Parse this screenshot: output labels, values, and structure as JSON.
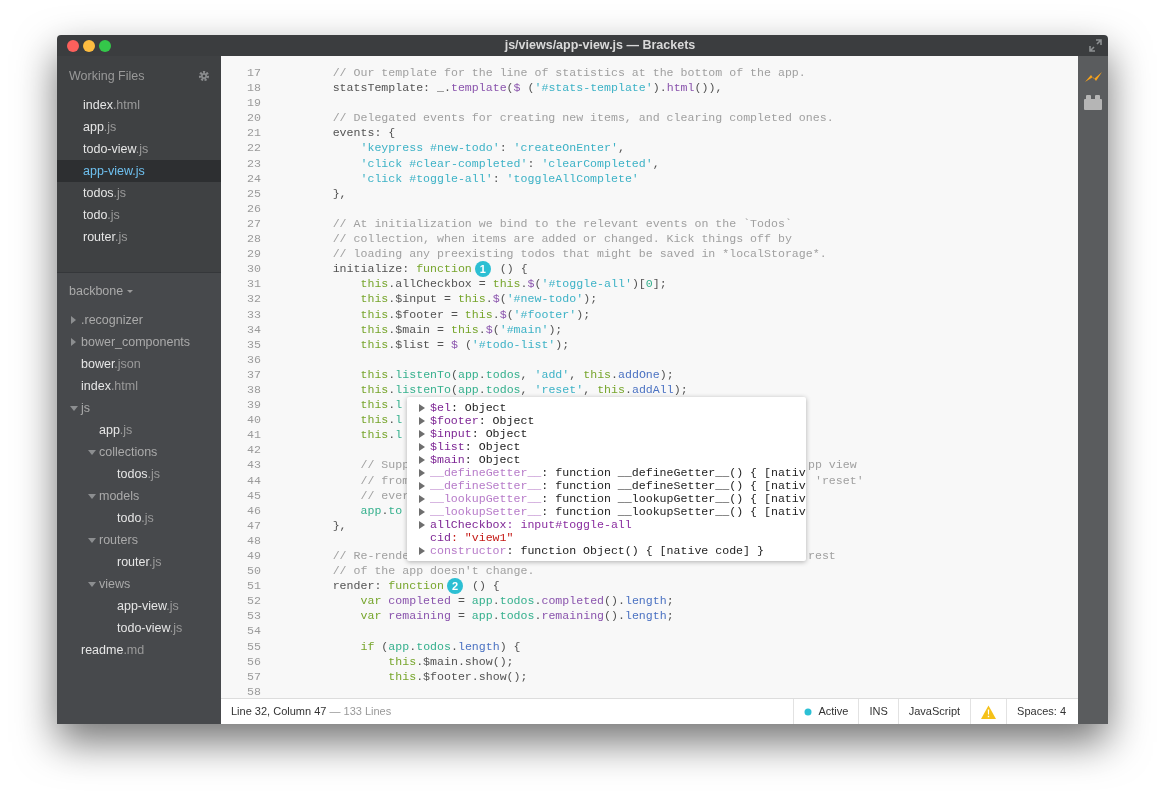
{
  "window": {
    "title": "js/views/app-view.js — Brackets"
  },
  "sidebar": {
    "working_files_title": "Working Files",
    "working_files": [
      {
        "name": "index",
        "ext": ".html",
        "selected": false
      },
      {
        "name": "app",
        "ext": ".js",
        "selected": false
      },
      {
        "name": "todo-view",
        "ext": ".js",
        "selected": false
      },
      {
        "name": "app-view",
        "ext": ".js",
        "selected": true
      },
      {
        "name": "todos",
        "ext": ".js",
        "selected": false
      },
      {
        "name": "todo",
        "ext": ".js",
        "selected": false
      },
      {
        "name": "router",
        "ext": ".js",
        "selected": false
      }
    ],
    "project": "backbone",
    "tree": [
      {
        "kind": "folder",
        "name": ".recognizer",
        "expanded": false
      },
      {
        "kind": "folder",
        "name": "bower_components",
        "expanded": false
      },
      {
        "kind": "file",
        "name": "bower",
        "ext": ".json"
      },
      {
        "kind": "file",
        "name": "index",
        "ext": ".html"
      },
      {
        "kind": "folder",
        "name": "js",
        "expanded": true,
        "children": [
          {
            "kind": "file",
            "name": "app",
            "ext": ".js"
          },
          {
            "kind": "folder",
            "name": "collections",
            "expanded": true,
            "children": [
              {
                "kind": "file",
                "name": "todos",
                "ext": ".js"
              }
            ]
          },
          {
            "kind": "folder",
            "name": "models",
            "expanded": true,
            "children": [
              {
                "kind": "file",
                "name": "todo",
                "ext": ".js"
              }
            ]
          },
          {
            "kind": "folder",
            "name": "routers",
            "expanded": true,
            "children": [
              {
                "kind": "file",
                "name": "router",
                "ext": ".js"
              }
            ]
          },
          {
            "kind": "folder",
            "name": "views",
            "expanded": true,
            "children": [
              {
                "kind": "file",
                "name": "app-view",
                "ext": ".js"
              },
              {
                "kind": "file",
                "name": "todo-view",
                "ext": ".js"
              }
            ]
          }
        ]
      },
      {
        "kind": "file",
        "name": "readme",
        "ext": ".md"
      }
    ]
  },
  "editor": {
    "lines": [
      {
        "number": "17",
        "tokens": [
          {
            "text": "        // Our template for the line of statistics at the bottom of the app.",
            "kind": "comment"
          }
        ]
      },
      {
        "number": "18",
        "tokens": [
          {
            "text": "        statsTemplate: _.",
            "kind": "plain"
          },
          {
            "text": "template",
            "kind": "func"
          },
          {
            "text": "(",
            "kind": "plain"
          },
          {
            "text": "$",
            "kind": "func"
          },
          {
            "text": " (",
            "kind": "plain"
          },
          {
            "text": "'#stats-template'",
            "kind": "string"
          },
          {
            "text": ").",
            "kind": "plain"
          },
          {
            "text": "html",
            "kind": "func"
          },
          {
            "text": "()),",
            "kind": "plain"
          }
        ]
      },
      {
        "number": "19"
      },
      {
        "number": "20",
        "tokens": [
          {
            "text": "        // Delegated events for creating new items, and clearing completed ones.",
            "kind": "comment"
          }
        ]
      },
      {
        "number": "21",
        "tokens": [
          {
            "text": "        events: {",
            "kind": "plain"
          }
        ]
      },
      {
        "number": "22",
        "tokens": [
          {
            "text": "            'keypress #new-todo'",
            "kind": "string"
          },
          {
            "text": ": ",
            "kind": "plain"
          },
          {
            "text": "'createOnEnter'",
            "kind": "string"
          },
          {
            "text": ",",
            "kind": "plain"
          }
        ]
      },
      {
        "number": "23",
        "tokens": [
          {
            "text": "            'click #clear-completed'",
            "kind": "string"
          },
          {
            "text": ": ",
            "kind": "plain"
          },
          {
            "text": "'clearCompleted'",
            "kind": "string"
          },
          {
            "text": ",",
            "kind": "plain"
          }
        ]
      },
      {
        "number": "24",
        "tokens": [
          {
            "text": "            'click #toggle-all'",
            "kind": "string"
          },
          {
            "text": ": ",
            "kind": "plain"
          },
          {
            "text": "'toggleAllComplete'",
            "kind": "string"
          }
        ]
      },
      {
        "number": "25",
        "tokens": [
          {
            "text": "        },",
            "kind": "plain"
          }
        ]
      },
      {
        "number": "26"
      },
      {
        "number": "27",
        "tokens": [
          {
            "text": "        // At initialization we bind to the relevant events on the `Todos`",
            "kind": "comment"
          }
        ]
      },
      {
        "number": "28",
        "tokens": [
          {
            "text": "        // collection, when items are added or changed. Kick things off by",
            "kind": "comment"
          }
        ]
      },
      {
        "number": "29",
        "tokens": [
          {
            "text": "        // loading any preexisting todos that might be saved in *localStorage*.",
            "kind": "comment"
          }
        ]
      },
      {
        "number": "30",
        "tokens": [
          {
            "text": "        initialize: ",
            "kind": "plain"
          },
          {
            "text": "function",
            "kind": "keyword"
          },
          {
            "text": "1",
            "kind": "badge"
          },
          {
            "text": "() {",
            "kind": "plain"
          }
        ]
      },
      {
        "number": "31",
        "tokens": [
          {
            "text": "            this",
            "kind": "keyword"
          },
          {
            "text": ".allCheckbox = ",
            "kind": "plain"
          },
          {
            "text": "this",
            "kind": "keyword"
          },
          {
            "text": ".",
            "kind": "plain"
          },
          {
            "text": "$",
            "kind": "func"
          },
          {
            "text": "(",
            "kind": "plain"
          },
          {
            "text": "'#toggle-all'",
            "kind": "string"
          },
          {
            "text": ")[",
            "kind": "plain"
          },
          {
            "text": "0",
            "kind": "ident"
          },
          {
            "text": "];",
            "kind": "plain"
          }
        ]
      },
      {
        "number": "32",
        "tokens": [
          {
            "text": "            this",
            "kind": "keyword"
          },
          {
            "text": ".$input = ",
            "kind": "plain"
          },
          {
            "text": "this",
            "kind": "keyword"
          },
          {
            "text": ".",
            "kind": "plain"
          },
          {
            "text": "$",
            "kind": "func"
          },
          {
            "text": "(",
            "kind": "plain"
          },
          {
            "text": "'#new-todo'",
            "kind": "string"
          },
          {
            "text": ");",
            "kind": "plain"
          }
        ]
      },
      {
        "number": "33",
        "tokens": [
          {
            "text": "            this",
            "kind": "keyword"
          },
          {
            "text": ".$footer = ",
            "kind": "plain"
          },
          {
            "text": "this",
            "kind": "keyword"
          },
          {
            "text": ".",
            "kind": "plain"
          },
          {
            "text": "$",
            "kind": "func"
          },
          {
            "text": "(",
            "kind": "plain"
          },
          {
            "text": "'#footer'",
            "kind": "string"
          },
          {
            "text": ");",
            "kind": "plain"
          }
        ]
      },
      {
        "number": "34",
        "tokens": [
          {
            "text": "            this",
            "kind": "keyword"
          },
          {
            "text": ".$main = ",
            "kind": "plain"
          },
          {
            "text": "this",
            "kind": "keyword"
          },
          {
            "text": ".",
            "kind": "plain"
          },
          {
            "text": "$",
            "kind": "func"
          },
          {
            "text": "(",
            "kind": "plain"
          },
          {
            "text": "'#main'",
            "kind": "string"
          },
          {
            "text": ");",
            "kind": "plain"
          }
        ]
      },
      {
        "number": "35",
        "tokens": [
          {
            "text": "            this",
            "kind": "keyword"
          },
          {
            "text": ".$list = ",
            "kind": "plain"
          },
          {
            "text": "$",
            "kind": "func"
          },
          {
            "text": " (",
            "kind": "plain"
          },
          {
            "text": "'#todo-list'",
            "kind": "string"
          },
          {
            "text": ");",
            "kind": "plain"
          }
        ]
      },
      {
        "number": "36"
      },
      {
        "number": "37",
        "tokens": [
          {
            "text": "            this",
            "kind": "keyword"
          },
          {
            "text": ".",
            "kind": "plain"
          },
          {
            "text": "listenTo",
            "kind": "ident"
          },
          {
            "text": "(",
            "kind": "plain"
          },
          {
            "text": "app",
            "kind": "ident"
          },
          {
            "text": ".",
            "kind": "plain"
          },
          {
            "text": "todos",
            "kind": "ident"
          },
          {
            "text": ", ",
            "kind": "plain"
          },
          {
            "text": "'add'",
            "kind": "string"
          },
          {
            "text": ", ",
            "kind": "plain"
          },
          {
            "text": "this",
            "kind": "keyword"
          },
          {
            "text": ".",
            "kind": "plain"
          },
          {
            "text": "addOne",
            "kind": "prop"
          },
          {
            "text": ");",
            "kind": "plain"
          }
        ]
      },
      {
        "number": "38",
        "tokens": [
          {
            "text": "            this",
            "kind": "keyword"
          },
          {
            "text": ".",
            "kind": "plain"
          },
          {
            "text": "listenTo",
            "kind": "ident"
          },
          {
            "text": "(",
            "kind": "plain"
          },
          {
            "text": "app",
            "kind": "ident"
          },
          {
            "text": ".",
            "kind": "plain"
          },
          {
            "text": "todos",
            "kind": "ident"
          },
          {
            "text": ", ",
            "kind": "plain"
          },
          {
            "text": "'reset'",
            "kind": "string"
          },
          {
            "text": ", ",
            "kind": "plain"
          },
          {
            "text": "this",
            "kind": "keyword"
          },
          {
            "text": ".",
            "kind": "plain"
          },
          {
            "text": "addAll",
            "kind": "prop"
          },
          {
            "text": ");",
            "kind": "plain"
          }
        ]
      },
      {
        "number": "39",
        "tokens": [
          {
            "text": "            this",
            "kind": "keyword"
          },
          {
            "text": ".",
            "kind": "plain"
          },
          {
            "text": "l",
            "kind": "ident"
          }
        ]
      },
      {
        "number": "40",
        "tokens": [
          {
            "text": "            this",
            "kind": "keyword"
          },
          {
            "text": ".",
            "kind": "plain"
          },
          {
            "text": "l",
            "kind": "ident"
          }
        ]
      },
      {
        "number": "41",
        "tokens": [
          {
            "text": "            this",
            "kind": "keyword"
          },
          {
            "text": ".",
            "kind": "plain"
          },
          {
            "text": "l",
            "kind": "ident"
          }
        ]
      },
      {
        "number": "42"
      },
      {
        "number": "43",
        "tokens": [
          {
            "text": "            // Supp",
            "kind": "comment"
          }
        ],
        "after": [
          {
            "text": "pp view",
            "kind": "comment"
          }
        ]
      },
      {
        "number": "44",
        "tokens": [
          {
            "text": "            // from",
            "kind": "comment"
          }
        ],
        "after": [
          {
            "text": " 'reset'",
            "kind": "comment"
          }
        ]
      },
      {
        "number": "45",
        "tokens": [
          {
            "text": "            // ever",
            "kind": "comment"
          }
        ]
      },
      {
        "number": "46",
        "tokens": [
          {
            "text": "            app",
            "kind": "ident"
          },
          {
            "text": ".",
            "kind": "plain"
          },
          {
            "text": "to",
            "kind": "ident"
          }
        ]
      },
      {
        "number": "47",
        "tokens": [
          {
            "text": "        },",
            "kind": "plain"
          }
        ]
      },
      {
        "number": "48"
      },
      {
        "number": "49",
        "tokens": [
          {
            "text": "        // Re-rende",
            "kind": "comment"
          }
        ],
        "after": [
          {
            "text": "rest",
            "kind": "comment"
          }
        ]
      },
      {
        "number": "50",
        "tokens": [
          {
            "text": "        // of the app doesn't change.",
            "kind": "comment"
          }
        ]
      },
      {
        "number": "51",
        "tokens": [
          {
            "text": "        render: ",
            "kind": "plain"
          },
          {
            "text": "function",
            "kind": "keyword"
          },
          {
            "text": "2",
            "kind": "badge"
          },
          {
            "text": "() {",
            "kind": "plain"
          }
        ]
      },
      {
        "number": "52",
        "tokens": [
          {
            "text": "            var",
            "kind": "keyword"
          },
          {
            "text": " completed",
            "kind": "func"
          },
          {
            "text": " = ",
            "kind": "plain"
          },
          {
            "text": "app",
            "kind": "ident"
          },
          {
            "text": ".",
            "kind": "plain"
          },
          {
            "text": "todos",
            "kind": "ident"
          },
          {
            "text": ".",
            "kind": "plain"
          },
          {
            "text": "completed",
            "kind": "func"
          },
          {
            "text": "().",
            "kind": "plain"
          },
          {
            "text": "length",
            "kind": "prop"
          },
          {
            "text": ";",
            "kind": "plain"
          }
        ]
      },
      {
        "number": "53",
        "tokens": [
          {
            "text": "            var",
            "kind": "keyword"
          },
          {
            "text": " remaining",
            "kind": "func"
          },
          {
            "text": " = ",
            "kind": "plain"
          },
          {
            "text": "app",
            "kind": "ident"
          },
          {
            "text": ".",
            "kind": "plain"
          },
          {
            "text": "todos",
            "kind": "ident"
          },
          {
            "text": ".",
            "kind": "plain"
          },
          {
            "text": "remaining",
            "kind": "func"
          },
          {
            "text": "().",
            "kind": "plain"
          },
          {
            "text": "length",
            "kind": "prop"
          },
          {
            "text": ";",
            "kind": "plain"
          }
        ]
      },
      {
        "number": "54"
      },
      {
        "number": "55",
        "tokens": [
          {
            "text": "            if",
            "kind": "keyword"
          },
          {
            "text": " (",
            "kind": "plain"
          },
          {
            "text": "app",
            "kind": "ident"
          },
          {
            "text": ".",
            "kind": "plain"
          },
          {
            "text": "todos",
            "kind": "ident"
          },
          {
            "text": ".",
            "kind": "plain"
          },
          {
            "text": "length",
            "kind": "prop"
          },
          {
            "text": ") {",
            "kind": "plain"
          }
        ]
      },
      {
        "number": "56",
        "tokens": [
          {
            "text": "                this",
            "kind": "keyword"
          },
          {
            "text": ".$main.show();",
            "kind": "plain"
          }
        ]
      },
      {
        "number": "57",
        "tokens": [
          {
            "text": "                this",
            "kind": "keyword"
          },
          {
            "text": ".$footer.show();",
            "kind": "plain"
          }
        ]
      },
      {
        "number": "58"
      }
    ],
    "hint": [
      {
        "key": "$el",
        "value": ": Object",
        "expandable": true,
        "inherited": false,
        "kind": "object"
      },
      {
        "key": "$footer",
        "value": ": Object",
        "expandable": true,
        "inherited": false,
        "kind": "object"
      },
      {
        "key": "$input",
        "value": ": Object",
        "expandable": true,
        "inherited": false,
        "kind": "object"
      },
      {
        "key": "$list",
        "value": ": Object",
        "expandable": true,
        "inherited": false,
        "kind": "object"
      },
      {
        "key": "$main",
        "value": ": Object",
        "expandable": true,
        "inherited": false,
        "kind": "object"
      },
      {
        "key": "__defineGetter__",
        "value": ": function __defineGetter__() { [nativ",
        "expandable": true,
        "inherited": true,
        "kind": "object"
      },
      {
        "key": "__defineSetter__",
        "value": ": function __defineSetter__() { [nativ",
        "expandable": true,
        "inherited": true,
        "kind": "object"
      },
      {
        "key": "__lookupGetter__",
        "value": ": function __lookupGetter__() { [nativ",
        "expandable": true,
        "inherited": true,
        "kind": "object"
      },
      {
        "key": "__lookupSetter__",
        "value": ": function __lookupSetter__() { [nativ",
        "expandable": true,
        "inherited": true,
        "kind": "object"
      },
      {
        "key": "allCheckbox",
        "value": ": input#toggle-all",
        "expandable": true,
        "inherited": false,
        "kind": "element"
      },
      {
        "key": "cid",
        "value": ": \"view1\"",
        "expandable": false,
        "inherited": false,
        "kind": "string"
      },
      {
        "key": "constructor",
        "value": ": function Object() { [native code] }",
        "expandable": true,
        "inherited": true,
        "kind": "object"
      }
    ]
  },
  "status_bar": {
    "position": "Line 32, Column 47",
    "line_count": "— 133 Lines",
    "state": "Active",
    "mode": "INS",
    "language": "JavaScript",
    "indent": "Spaces: 4"
  }
}
